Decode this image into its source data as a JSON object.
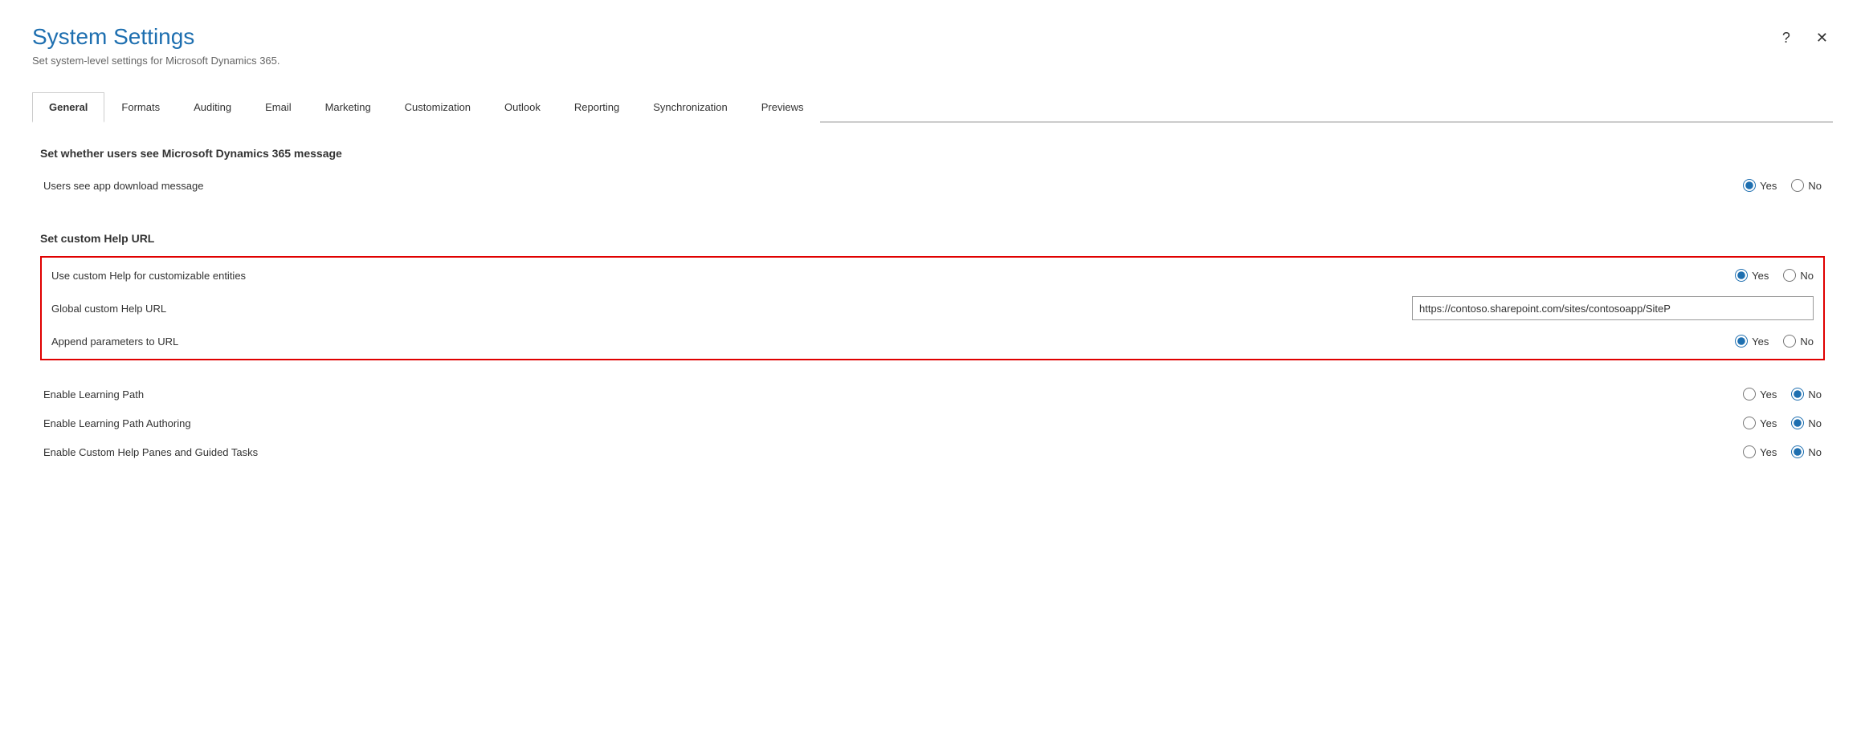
{
  "dialog": {
    "title": "System Settings",
    "subtitle": "Set system-level settings for Microsoft Dynamics 365."
  },
  "tabs": [
    {
      "id": "general",
      "label": "General",
      "active": true
    },
    {
      "id": "formats",
      "label": "Formats",
      "active": false
    },
    {
      "id": "auditing",
      "label": "Auditing",
      "active": false
    },
    {
      "id": "email",
      "label": "Email",
      "active": false
    },
    {
      "id": "marketing",
      "label": "Marketing",
      "active": false
    },
    {
      "id": "customization",
      "label": "Customization",
      "active": false
    },
    {
      "id": "outlook",
      "label": "Outlook",
      "active": false
    },
    {
      "id": "reporting",
      "label": "Reporting",
      "active": false
    },
    {
      "id": "synchronization",
      "label": "Synchronization",
      "active": false
    },
    {
      "id": "previews",
      "label": "Previews",
      "active": false
    }
  ],
  "sections": [
    {
      "id": "dynamics-message",
      "title": "Set whether users see Microsoft Dynamics 365 message",
      "highlighted": false,
      "settings": [
        {
          "id": "app-download-message",
          "label": "Users see app download message",
          "type": "radio",
          "value": "yes",
          "options": [
            "Yes",
            "No"
          ]
        }
      ]
    },
    {
      "id": "custom-help",
      "title": "Set custom Help URL",
      "highlighted": false,
      "settings": []
    },
    {
      "id": "custom-help-highlighted",
      "title": "",
      "highlighted": true,
      "settings": [
        {
          "id": "use-custom-help",
          "label": "Use custom Help for customizable entities",
          "type": "radio",
          "value": "yes",
          "options": [
            "Yes",
            "No"
          ]
        },
        {
          "id": "global-custom-help-url",
          "label": "Global custom Help URL",
          "type": "text",
          "value": "https://contoso.sharepoint.com/sites/contosoapp/SiteP"
        },
        {
          "id": "append-params",
          "label": "Append parameters to URL",
          "type": "radio",
          "value": "yes",
          "options": [
            "Yes",
            "No"
          ]
        }
      ]
    },
    {
      "id": "learning-path",
      "title": "",
      "highlighted": false,
      "settings": [
        {
          "id": "enable-learning-path",
          "label": "Enable Learning Path",
          "type": "radio",
          "value": "no",
          "options": [
            "Yes",
            "No"
          ]
        },
        {
          "id": "enable-learning-path-authoring",
          "label": "Enable Learning Path Authoring",
          "type": "radio",
          "value": "no",
          "options": [
            "Yes",
            "No"
          ]
        },
        {
          "id": "enable-custom-help-panes",
          "label": "Enable Custom Help Panes and Guided Tasks",
          "type": "radio",
          "value": "no",
          "options": [
            "Yes",
            "No"
          ]
        }
      ]
    }
  ],
  "icons": {
    "question": "?",
    "close": "✕"
  }
}
